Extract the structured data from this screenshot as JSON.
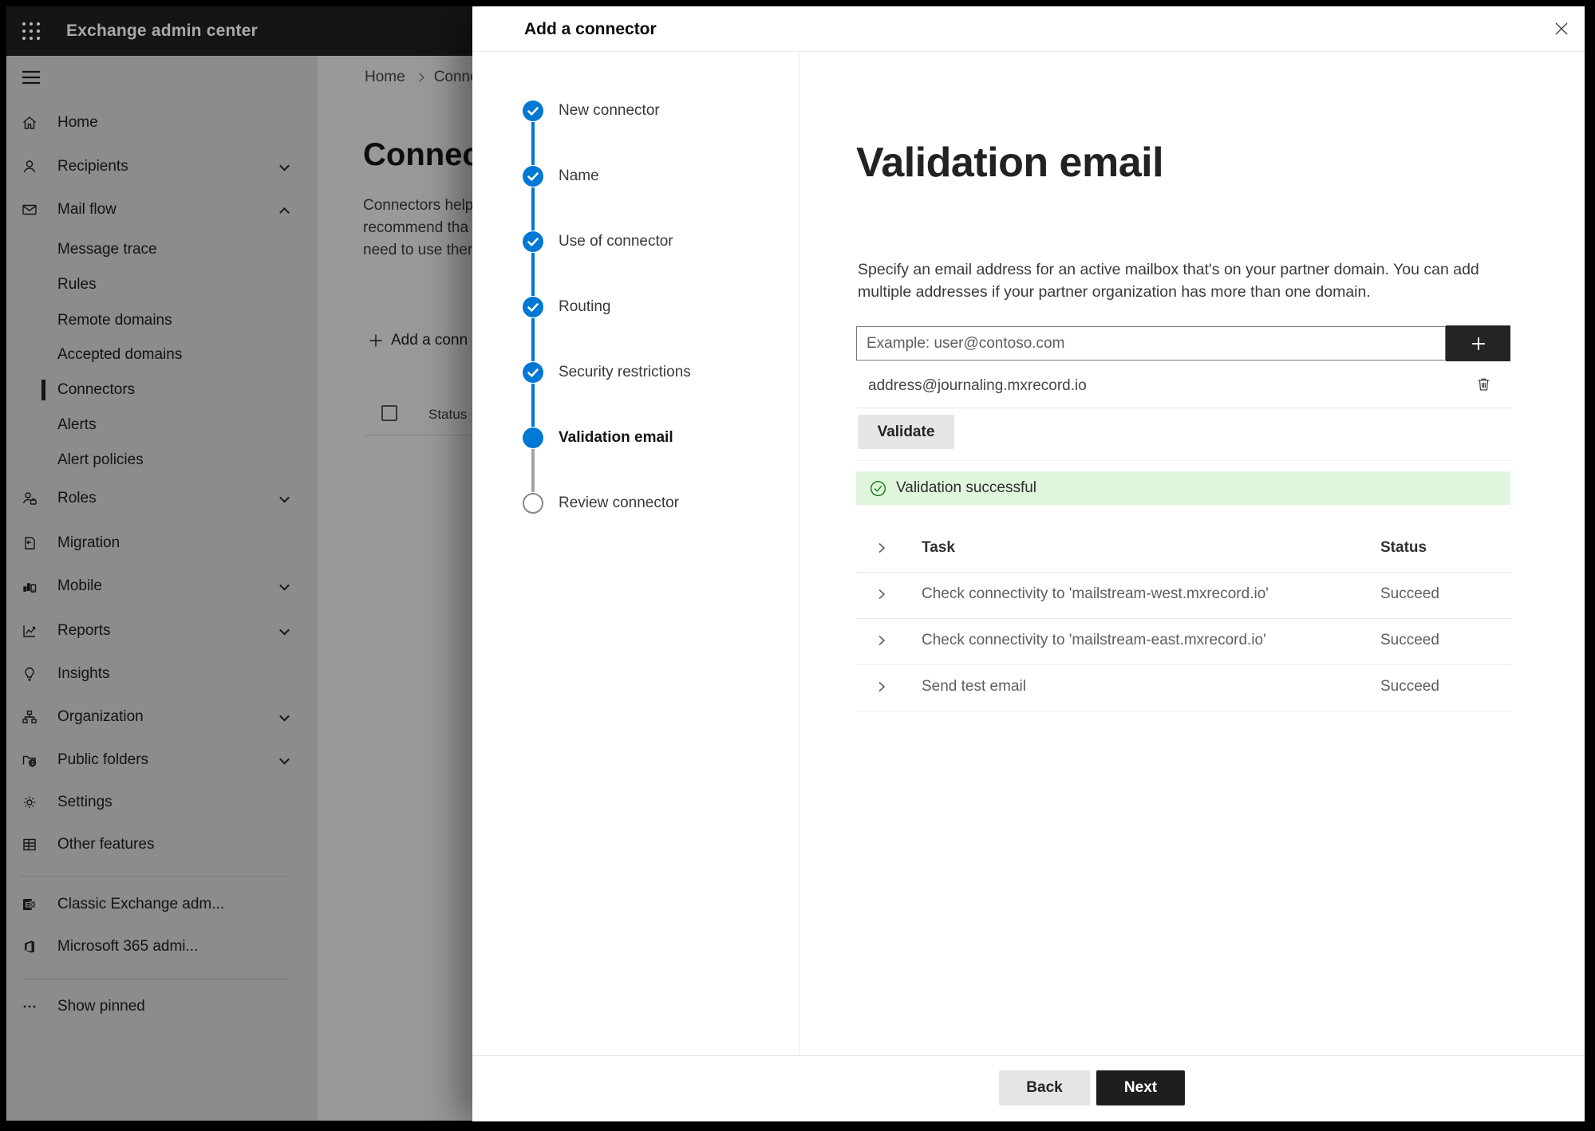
{
  "topbar": {
    "title": "Exchange admin center"
  },
  "sidebar": {
    "items": [
      {
        "label": "Home",
        "icon": "home-icon"
      },
      {
        "label": "Recipients",
        "icon": "person-icon",
        "chevron": "down"
      },
      {
        "label": "Mail flow",
        "icon": "mail-icon",
        "chevron": "up"
      },
      {
        "label": "Message trace",
        "indent": true
      },
      {
        "label": "Rules",
        "indent": true
      },
      {
        "label": "Remote domains",
        "indent": true
      },
      {
        "label": "Accepted domains",
        "indent": true
      },
      {
        "label": "Connectors",
        "indent": true,
        "selected": true
      },
      {
        "label": "Alerts",
        "indent": true
      },
      {
        "label": "Alert policies",
        "indent": true
      },
      {
        "label": "Roles",
        "icon": "roles-icon",
        "chevron": "down"
      },
      {
        "label": "Migration",
        "icon": "migration-icon"
      },
      {
        "label": "Mobile",
        "icon": "mobile-icon",
        "chevron": "down"
      },
      {
        "label": "Reports",
        "icon": "reports-icon",
        "chevron": "down"
      },
      {
        "label": "Insights",
        "icon": "lightbulb-icon"
      },
      {
        "label": "Organization",
        "icon": "org-chart-icon",
        "chevron": "down"
      },
      {
        "label": "Public folders",
        "icon": "folder-globe-icon",
        "chevron": "down"
      },
      {
        "label": "Settings",
        "icon": "gear-icon"
      },
      {
        "label": "Other features",
        "icon": "table-grid-icon"
      },
      {
        "label": "Classic Exchange adm...",
        "icon": "classic-exchange-icon"
      },
      {
        "label": "Microsoft 365 admi...",
        "icon": "microsoft-365-icon"
      },
      {
        "label": "Show pinned",
        "icon": "ellipsis-icon"
      }
    ]
  },
  "background": {
    "breadcrumb": {
      "home": "Home",
      "current": "Conne"
    },
    "heading": "Connec",
    "description_lines": [
      "Connectors help",
      "recommend tha",
      "need to use ther"
    ],
    "add_button": "Add a conn",
    "status_header": "Status"
  },
  "dialog": {
    "title": "Add a connector",
    "steps": [
      {
        "label": "New connector",
        "state": "completed"
      },
      {
        "label": "Name",
        "state": "completed"
      },
      {
        "label": "Use of connector",
        "state": "completed"
      },
      {
        "label": "Routing",
        "state": "completed"
      },
      {
        "label": "Security restrictions",
        "state": "completed"
      },
      {
        "label": "Validation email",
        "state": "active"
      },
      {
        "label": "Review connector",
        "state": "upcoming"
      }
    ],
    "content": {
      "heading": "Validation email",
      "description_lines": [
        "Specify an email address for an active mailbox that's on your partner domain. You can add",
        "multiple addresses if your partner organization has more than one domain."
      ],
      "email_input_placeholder": "Example: user@contoso.com",
      "added_address": "address@journaling.mxrecord.io",
      "validate_button": "Validate",
      "validation_banner": "Validation successful",
      "table": {
        "headers": {
          "task": "Task",
          "status": "Status"
        },
        "rows": [
          {
            "task": "Check connectivity to 'mailstream-west.mxrecord.io'",
            "status": "Succeed"
          },
          {
            "task": "Check connectivity to 'mailstream-east.mxrecord.io'",
            "status": "Succeed"
          },
          {
            "task": "Send test email",
            "status": "Succeed"
          }
        ]
      }
    },
    "footer": {
      "back_button": "Back",
      "next_button": "Next"
    }
  },
  "colors": {
    "accent": "#0078d4",
    "success_green": "#107c10",
    "banner_green_bg": "#dff6dd"
  }
}
